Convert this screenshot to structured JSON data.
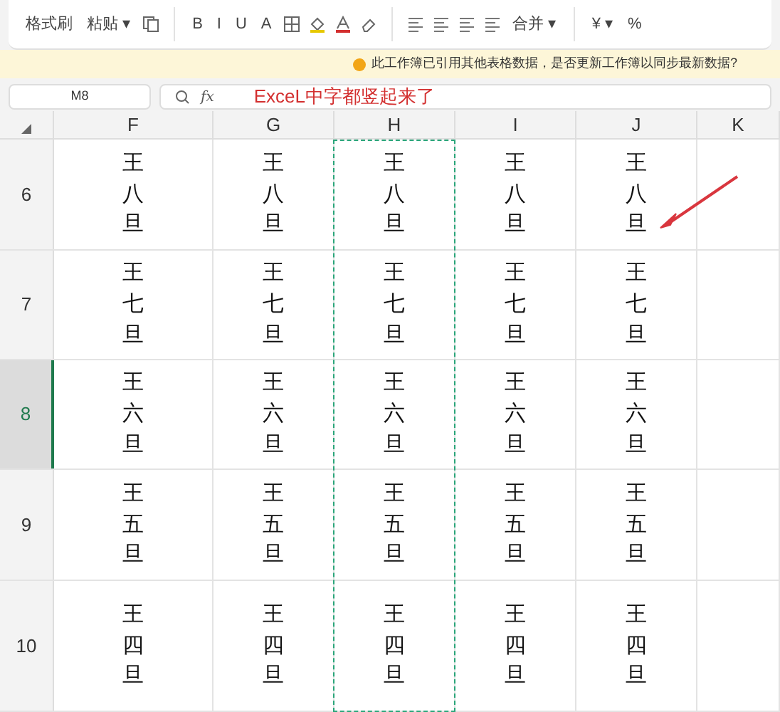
{
  "ribbon": {
    "items": [
      {
        "kind": "text",
        "label": "格式刷"
      },
      {
        "kind": "text",
        "label": "粘贴 ▾"
      },
      {
        "kind": "copy"
      },
      {
        "kind": "sep"
      },
      {
        "kind": "text",
        "label": "B"
      },
      {
        "kind": "text",
        "label": "I"
      },
      {
        "kind": "text",
        "label": "U"
      },
      {
        "kind": "text",
        "label": "A"
      },
      {
        "kind": "border"
      },
      {
        "kind": "fill"
      },
      {
        "kind": "fontcolor"
      },
      {
        "kind": "eraser"
      },
      {
        "kind": "sep"
      },
      {
        "kind": "align"
      },
      {
        "kind": "align"
      },
      {
        "kind": "align"
      },
      {
        "kind": "align"
      },
      {
        "kind": "text",
        "label": "合并 ▾"
      },
      {
        "kind": "sep"
      },
      {
        "kind": "text",
        "label": "¥ ▾"
      },
      {
        "kind": "text",
        "label": "%"
      }
    ]
  },
  "notification": {
    "text": "此工作簿已引用其他表格数据，是否更新工作簿以同步最新数据?"
  },
  "formula_bar": {
    "name_box": "M8",
    "fx": "fx",
    "value": "ExceL中字都竖起来了"
  },
  "grid": {
    "columns": [
      {
        "label": "F",
        "selected": false,
        "copied": false
      },
      {
        "label": "G",
        "selected": false,
        "copied": false
      },
      {
        "label": "H",
        "selected": false,
        "copied": true
      },
      {
        "label": "I",
        "selected": false,
        "copied": false
      },
      {
        "label": "J",
        "selected": false,
        "copied": false
      },
      {
        "label": "K",
        "selected": false,
        "copied": false
      }
    ],
    "rows": [
      {
        "header": "6",
        "selected": false,
        "cells": [
          "王八旦",
          "王八旦",
          "王八旦",
          "王八旦",
          "王八旦",
          ""
        ]
      },
      {
        "header": "7",
        "selected": false,
        "cells": [
          "王七旦",
          "王七旦",
          "王七旦",
          "王七旦",
          "王七旦",
          ""
        ]
      },
      {
        "header": "8",
        "selected": true,
        "cells": [
          "王六旦",
          "王六旦",
          "王六旦",
          "王六旦",
          "王六旦",
          ""
        ]
      },
      {
        "header": "9",
        "selected": false,
        "cells": [
          "王五旦",
          "王五旦",
          "王五旦",
          "王五旦",
          "王五旦",
          ""
        ]
      },
      {
        "header": "10",
        "selected": false,
        "cells": [
          "王四旦",
          "王四旦",
          "王四旦",
          "王四旦",
          "王四旦",
          ""
        ]
      }
    ]
  }
}
